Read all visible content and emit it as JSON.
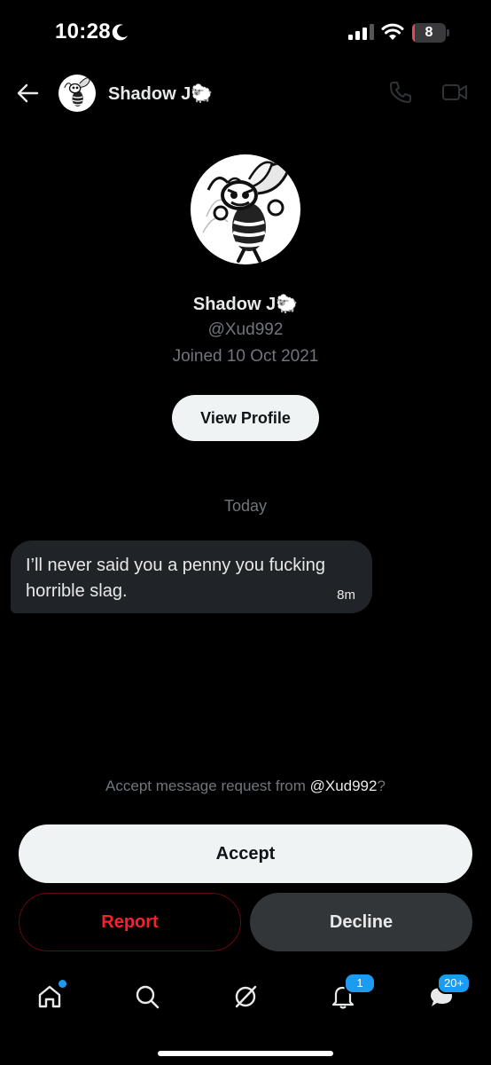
{
  "status_bar": {
    "time": "10:28",
    "battery_level": "8",
    "icons": [
      "moon-icon",
      "signal-icon",
      "wifi-icon",
      "battery-icon"
    ]
  },
  "header": {
    "back_icon": "arrow-left-icon",
    "name": "Shadow J🐑",
    "call_icon": "phone-icon",
    "video_icon": "video-camera-icon"
  },
  "profile": {
    "name": "Shadow J🐑",
    "handle": "@Xud992",
    "joined": "Joined 10 Oct 2021",
    "view_profile_label": "View Profile"
  },
  "conversation": {
    "date_separator": "Today",
    "messages": [
      {
        "text": "I’ll never said you a penny you fucking horrible slag.",
        "time": "8m"
      }
    ]
  },
  "request": {
    "prompt_prefix": "Accept message request from ",
    "prompt_handle": "@Xud992",
    "prompt_suffix": "?",
    "accept_label": "Accept",
    "report_label": "Report",
    "decline_label": "Decline"
  },
  "bottom_nav": {
    "items": [
      {
        "icon": "home-icon",
        "badge": "dot"
      },
      {
        "icon": "search-icon"
      },
      {
        "icon": "grok-icon"
      },
      {
        "icon": "bell-icon",
        "badge": "1"
      },
      {
        "icon": "messages-icon",
        "badge": "20+"
      }
    ]
  },
  "colors": {
    "background": "#000000",
    "accent": "#1d9bf0",
    "danger": "#f4212e",
    "secondary_text": "#71767b"
  }
}
